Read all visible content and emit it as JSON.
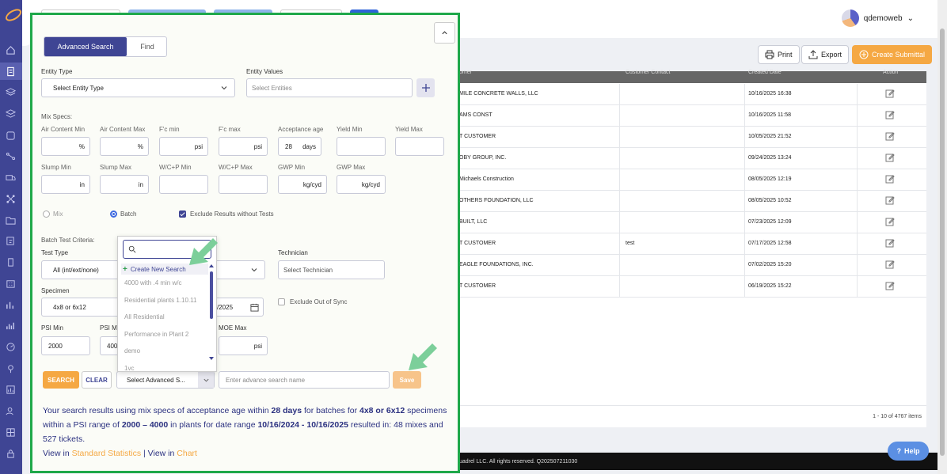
{
  "header": {
    "user_name": "qdemoweb"
  },
  "toolbar": {
    "print_label": "Print",
    "export_label": "Export",
    "create_label": "Create Submittal"
  },
  "table": {
    "columns": [
      "omer",
      "Customer Contact",
      "Created Date",
      "Action"
    ],
    "rows": [
      {
        "customer": "MILE CONCRETE WALLS, LLC",
        "contact": "",
        "date": "10/16/2025 16:38"
      },
      {
        "customer": "AMS CONST",
        "contact": "",
        "date": "10/16/2025 11:58"
      },
      {
        "customer": "T CUSTOMER",
        "contact": "",
        "date": "10/05/2025 21:52"
      },
      {
        "customer": "OBY GROUP, INC.",
        "contact": "",
        "date": "09/24/2025 13:24"
      },
      {
        "customer": "Michaels Construction",
        "contact": "",
        "date": "08/05/2025 12:19"
      },
      {
        "customer": "OTHERS FOUNDATION, LLC",
        "contact": "",
        "date": "08/05/2025 10:52"
      },
      {
        "customer": "BUILT, LLC",
        "contact": "",
        "date": "07/23/2025 12:09"
      },
      {
        "customer": "T CUSTOMER",
        "contact": "test",
        "date": "07/17/2025 12:58"
      },
      {
        "customer": "EAGLE FOUNDATIONS, INC.",
        "contact": "",
        "date": "07/02/2025 15:20"
      },
      {
        "customer": "T CUSTOMER",
        "contact": "",
        "date": "06/19/2025 15:22"
      }
    ],
    "pager_text": "1 - 10 of 4767 items"
  },
  "footer": {
    "text": "uadrel LLC. All rights reserved. Q202507211030"
  },
  "help_label": "Help",
  "panel": {
    "tabs": {
      "advanced": "Advanced Search",
      "find": "Find"
    },
    "entity_type_label": "Entity Type",
    "entity_type_value": "Select Entity Type",
    "entity_values_label": "Entity Values",
    "entity_values_placeholder": "Select Entities",
    "mix_specs_label": "Mix Specs:",
    "mix_fields": [
      {
        "label": "Air Content Min",
        "value": "",
        "unit": "%"
      },
      {
        "label": "Air Content Max",
        "value": "",
        "unit": "%"
      },
      {
        "label": "F'c min",
        "value": "",
        "unit": "psi"
      },
      {
        "label": "F'c max",
        "value": "",
        "unit": "psi"
      },
      {
        "label": "Acceptance age",
        "value": "28",
        "unit": "days"
      },
      {
        "label": "Yield Min",
        "value": "",
        "unit": ""
      },
      {
        "label": "Yield Max",
        "value": "",
        "unit": ""
      },
      {
        "label": "Slump Min",
        "value": "",
        "unit": "in"
      },
      {
        "label": "Slump Max",
        "value": "",
        "unit": "in"
      },
      {
        "label": "W/C+P Min",
        "value": "",
        "unit": ""
      },
      {
        "label": "W/C+P Max",
        "value": "",
        "unit": ""
      },
      {
        "label": "GWP Min",
        "value": "",
        "unit": "kg/cyd"
      },
      {
        "label": "GWP Max",
        "value": "",
        "unit": "kg/cyd"
      }
    ],
    "radio_mix": "Mix",
    "radio_batch": "Batch",
    "exclude_no_tests": "Exclude Results without Tests",
    "batch_criteria_label": "Batch Test Criteria:",
    "test_type_label": "Test Type",
    "test_type_value": "All (int/ext/none)",
    "technician_label": "Technician",
    "technician_placeholder": "Select Technician",
    "specimen_label": "Specimen",
    "specimen_value": "4x8 or 6x12",
    "date_value_fragment": "/2025",
    "exclude_out_of_sync": "Exclude Out of Sync",
    "psi_min_label": "PSI Min",
    "psi_min_value": "2000",
    "psi_max_label": "PSI M",
    "psi_max_value": "400",
    "moe_max_label": "MOE Max",
    "moe_unit": "psi",
    "search_btn": "SEARCH",
    "clear_btn": "CLEAR",
    "adv_select_value": "Select Advanced S...",
    "adv_name_placeholder": "Enter advance search name",
    "save_btn": "Save",
    "summary": {
      "p1": "Your search results using mix specs of acceptance age within ",
      "age": "28 days",
      "p2": " for batches for ",
      "spec": "4x8 or 6x12",
      "p3": " specimens within a PSI range of ",
      "range": "2000 – 4000",
      "p4": " in plants for date range ",
      "dates": "10/16/2024 - 10/16/2025",
      "p5": " resulted in: 48 mixes and 527 tickets.",
      "view_in": "View in ",
      "std_link": "Standard Statistics",
      "sep": " | View in ",
      "chart_link": "Chart"
    },
    "dropdown": {
      "create_new": "Create New Search",
      "items": [
        "4000 with .4 min w/c",
        "Residential plants 1.10.11",
        "All Residential",
        "Performance in Plant 2",
        "demo",
        "1vc"
      ]
    }
  },
  "colors": {
    "brand": "#3f4594",
    "accent": "#f5a843",
    "highlight_border": "#1fa84a",
    "arrow": "#7ccf9a"
  }
}
